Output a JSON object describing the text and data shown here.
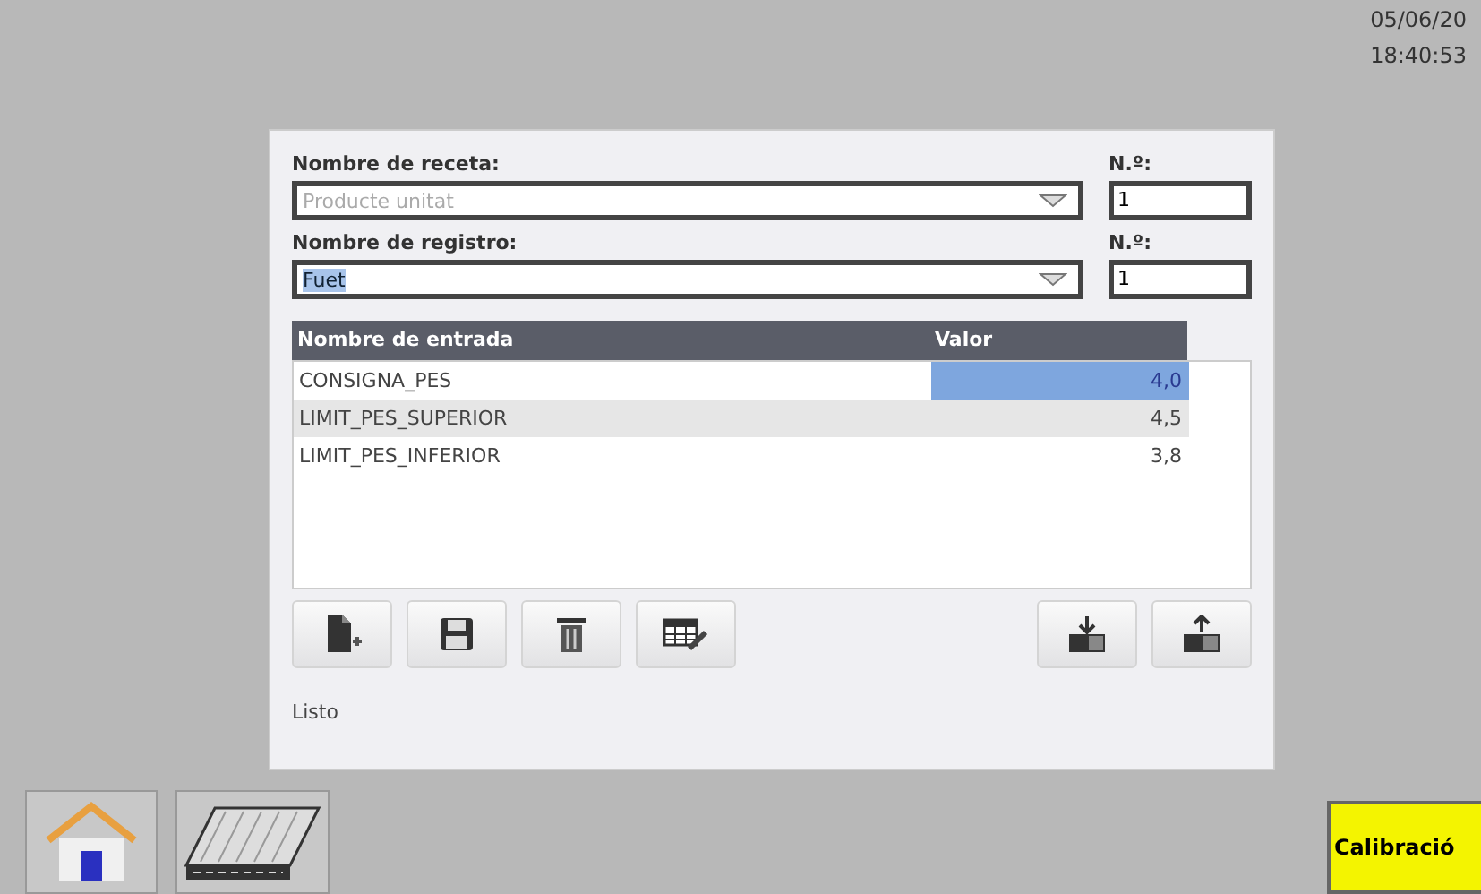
{
  "clock": {
    "date": "05/06/20",
    "time": "18:40:53"
  },
  "recipe": {
    "label": "Nombre de receta:",
    "value": "Producte unitat",
    "disabled": true,
    "number_label": "N.º:",
    "number": "1"
  },
  "record": {
    "label": "Nombre de registro:",
    "value": "Fuet",
    "highlighted": true,
    "number_label": "N.º:",
    "number": "1"
  },
  "table": {
    "columns": [
      "Nombre de entrada",
      "Valor"
    ],
    "rows": [
      {
        "name": "CONSIGNA_PES",
        "value": "4,0",
        "selected": true
      },
      {
        "name": "LIMIT_PES_SUPERIOR",
        "value": "4,5",
        "selected": false
      },
      {
        "name": "LIMIT_PES_INFERIOR",
        "value": "3,8",
        "selected": false
      }
    ]
  },
  "status": "Listo",
  "calibration_button": "Calibració"
}
